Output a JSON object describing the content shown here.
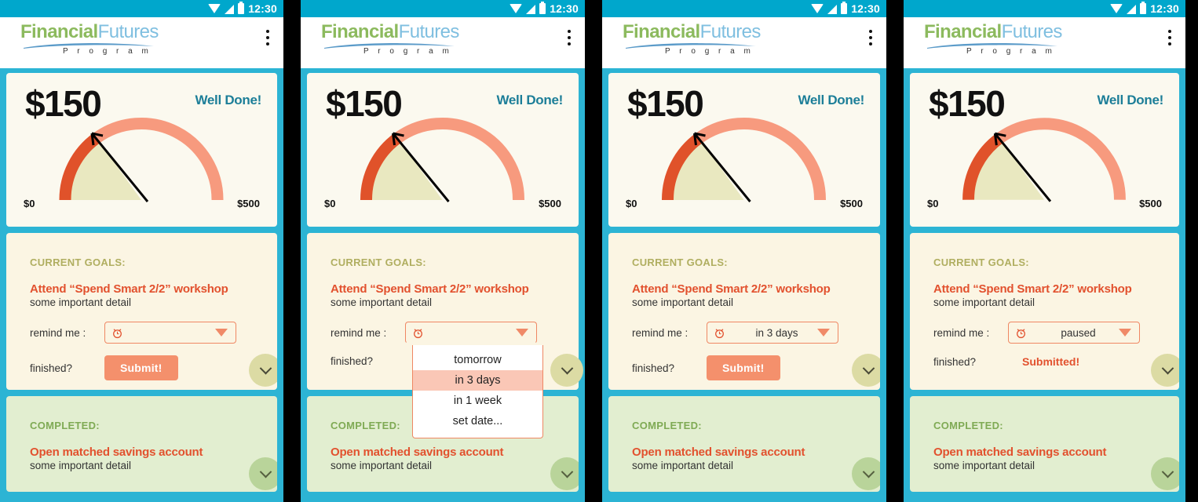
{
  "status_bar": {
    "time": "12:30",
    "icons": [
      "wifi-icon",
      "signal-icon",
      "battery-icon"
    ]
  },
  "app_bar": {
    "logo_primary": "Financial",
    "logo_secondary": "Futures",
    "logo_subtitle": "P r o g r a m",
    "overflow_menu": "kebab-menu-icon"
  },
  "gauge": {
    "amount": "$150",
    "praise": "Well Done!",
    "min_label": "$0",
    "max_label": "$500",
    "value": 150,
    "min": 0,
    "max": 500
  },
  "current_section": {
    "heading": "CURRENT GOALS:",
    "goal_title": "Attend “Spend Smart 2/2” workshop",
    "goal_detail": "some important detail",
    "remind_label": "remind me :",
    "finished_label": "finished?",
    "submit_label": "Submit!",
    "submitted_label": "Submitted!"
  },
  "completed_section": {
    "heading": "COMPLETED:",
    "goal_title": "Open matched savings account",
    "goal_detail": "some important detail"
  },
  "dropdown": {
    "options": [
      "tomorrow",
      "in 3 days",
      "in 1 week",
      "set date..."
    ],
    "highlighted": "in 3 days"
  },
  "panels": [
    {
      "reminder_value": "",
      "state": "empty-select"
    },
    {
      "reminder_value": "",
      "state": "dropdown-open"
    },
    {
      "reminder_value": "in 3 days",
      "state": "value-selected"
    },
    {
      "reminder_value": "paused",
      "state": "submitted"
    }
  ],
  "colors": {
    "status_bar": "#00a7cc",
    "page_bg": "#2cb4d4",
    "card_gauge_bg": "#fbf9ef",
    "card_current_bg": "#fbf5e3",
    "card_completed_bg": "#e2eed0",
    "accent_orange": "#e2512e",
    "submit_btn": "#f4906c",
    "select_border": "#ef8763",
    "praise_teal": "#1c7e98",
    "current_heading": "#b0ae60",
    "completed_heading": "#7faa54",
    "gauge_filled": "#e0522a",
    "gauge_track": "#f79a7e",
    "gauge_wedge": "#e9e8c0",
    "logo_green": "#8cba5e",
    "logo_blue": "#7fbfe0"
  }
}
